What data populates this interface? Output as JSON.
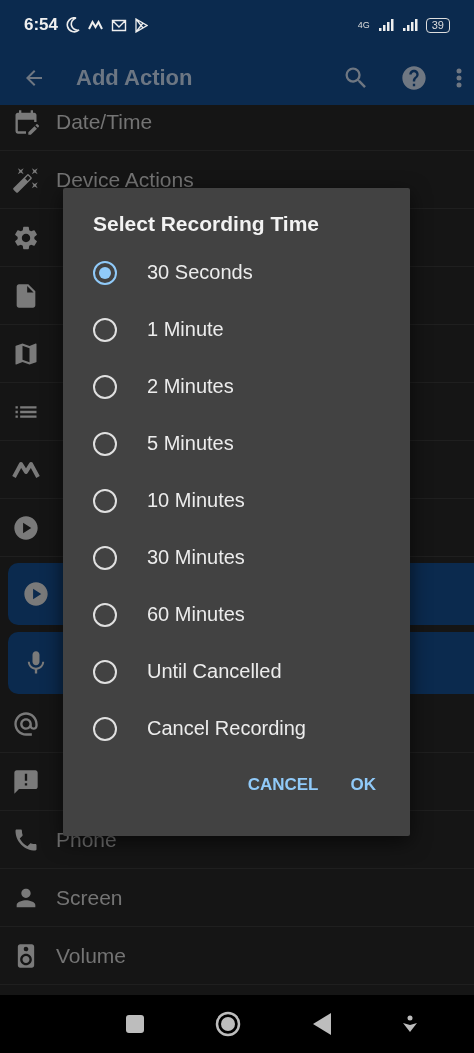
{
  "status_bar": {
    "time": "6:54",
    "network": "4G",
    "battery": "39"
  },
  "app_bar": {
    "title": "Add Action"
  },
  "categories": [
    {
      "kind": "plain",
      "label": "Date/Time"
    },
    {
      "kind": "plain",
      "label": "Device Actions"
    },
    {
      "kind": "plain"
    },
    {
      "kind": "plain"
    },
    {
      "kind": "plain"
    },
    {
      "kind": "plain"
    },
    {
      "kind": "plain"
    },
    {
      "kind": "plain"
    },
    {
      "kind": "highlighted"
    },
    {
      "kind": "highlighted"
    },
    {
      "kind": "plain"
    },
    {
      "kind": "plain"
    },
    {
      "kind": "plain",
      "label": "Phone"
    },
    {
      "kind": "plain",
      "label": "Screen"
    },
    {
      "kind": "plain",
      "label": "Volume"
    }
  ],
  "dialog": {
    "title": "Select Recording Time",
    "options": [
      {
        "label": "30 Seconds",
        "selected": true
      },
      {
        "label": "1 Minute",
        "selected": false
      },
      {
        "label": "2 Minutes",
        "selected": false
      },
      {
        "label": "5 Minutes",
        "selected": false
      },
      {
        "label": "10 Minutes",
        "selected": false
      },
      {
        "label": "30 Minutes",
        "selected": false
      },
      {
        "label": "60 Minutes",
        "selected": false
      },
      {
        "label": "Until Cancelled",
        "selected": false
      },
      {
        "label": "Cancel Recording",
        "selected": false
      }
    ],
    "buttons": [
      "CANCEL",
      "OK"
    ]
  }
}
